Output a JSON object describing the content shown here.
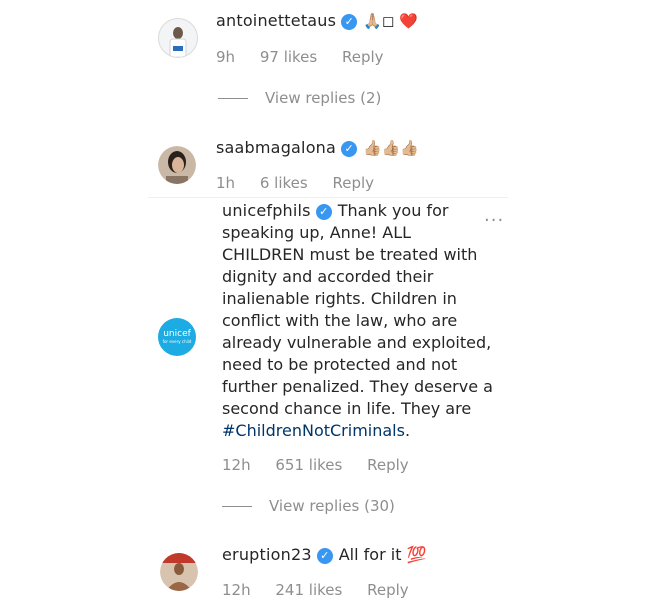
{
  "comments": [
    {
      "username": "antoinettetaus",
      "text": "🙏🏼◻ ❤️",
      "time": "9h",
      "likes": "97 likes",
      "reply": "Reply",
      "view_replies": "View replies (2)"
    },
    {
      "username": "saabmagalona",
      "text": "👍🏼👍🏼👍🏼",
      "time": "1h",
      "likes": "6 likes",
      "reply": "Reply"
    },
    {
      "username": "unicefphils",
      "text_lines": [
        "Thank you for",
        "speaking up, Anne! ALL",
        "CHILDREN must be treated with",
        "dignity and accorded their",
        "inalienable rights. Children in",
        "conflict with the law, who are",
        "already vulnerable and exploited,",
        "need to be protected and not",
        "further penalized. They deserve a",
        "second chance in life. They are"
      ],
      "hashtag": "#ChildrenNotCriminals",
      "hashtag_suffix": ".",
      "time": "12h",
      "likes": "651 likes",
      "reply": "Reply",
      "view_replies": "View replies (30)",
      "more": "...",
      "avatar_logo": "unicef",
      "avatar_tagline": "for every child"
    },
    {
      "username": "eruption23",
      "text": "All for it 💯",
      "time": "12h",
      "likes": "241 likes",
      "reply": "Reply"
    }
  ],
  "colors": {
    "verified": "#3897f0",
    "hashtag": "#003569",
    "meta": "#8e8e8e",
    "unicef": "#1cabe2"
  },
  "icons": [
    "verified-badge-icon",
    "more-options-icon"
  ]
}
